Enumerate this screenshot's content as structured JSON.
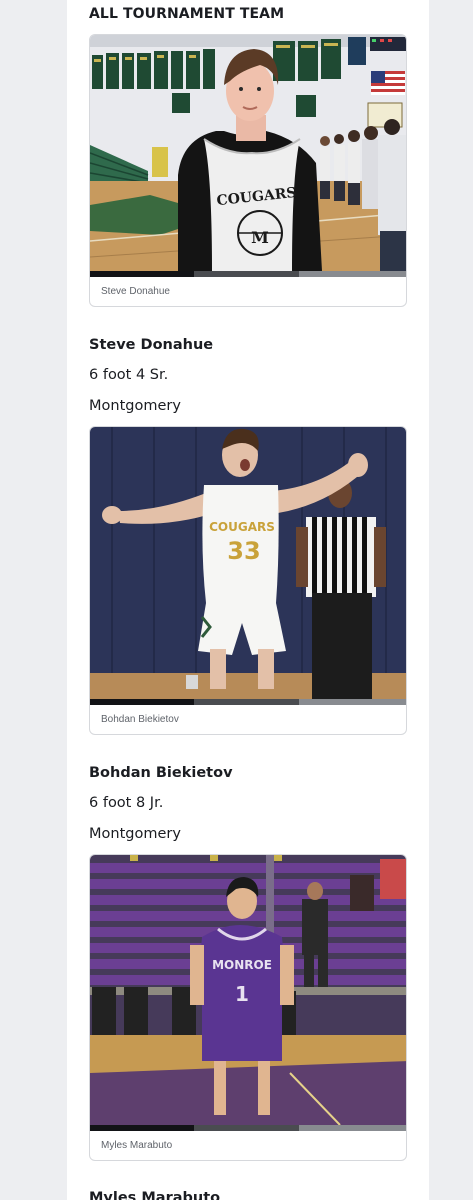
{
  "section": {
    "title": "ALL TOURNAMENT TEAM"
  },
  "players": [
    {
      "caption": "Steve Donahue",
      "name": "Steve Donahue",
      "height_year": "6 foot 4 Sr.",
      "school": "Montgomery",
      "jersey_text": "COUGARS",
      "jersey_letter": "M",
      "progress": {
        "played_fraction": 0.33,
        "buffered_fraction": 0.66
      }
    },
    {
      "caption": "Bohdan Biekietov",
      "name": "Bohdan Biekietov",
      "height_year": "6 foot 8 Jr.",
      "school": "Montgomery",
      "jersey_text": "COUGARS",
      "jersey_number": "33",
      "progress": {
        "played_fraction": 0.33,
        "buffered_fraction": 0.66
      }
    },
    {
      "caption": "Myles Marabuto",
      "name": "Myles Marabuto",
      "jersey_text": "MONROE",
      "jersey_number": "1",
      "progress": {
        "played_fraction": 0.33,
        "buffered_fraction": 0.66
      }
    }
  ],
  "colors": {
    "page_background": "#edeef1",
    "card_border": "#d6d8dc",
    "text_primary": "#1b1d22",
    "caption_text": "#5f636a",
    "progress_played": "#121316",
    "progress_buffer": "#4a4c50",
    "progress_track": "#888b90"
  }
}
